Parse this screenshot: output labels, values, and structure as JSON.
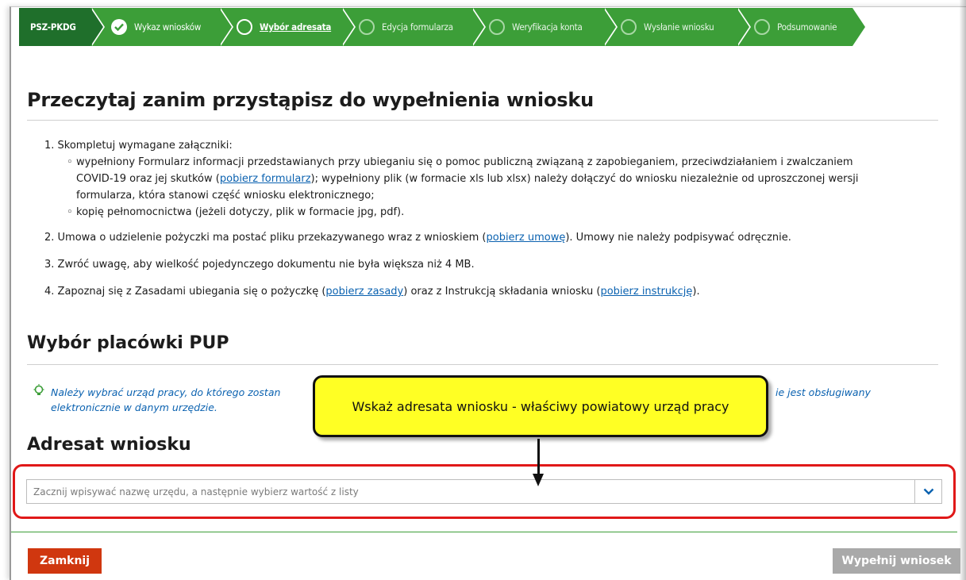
{
  "stepper": {
    "brand": "PSZ-PKDG",
    "steps": [
      {
        "label": "Wykaz wniosków",
        "state": "done"
      },
      {
        "label": "Wybór adresata",
        "state": "current"
      },
      {
        "label": "Edycja formularza",
        "state": "todo"
      },
      {
        "label": "Weryfikacja konta",
        "state": "todo"
      },
      {
        "label": "Wysłanie wniosku",
        "state": "todo"
      },
      {
        "label": "Podsumowanie",
        "state": "todo"
      }
    ]
  },
  "main": {
    "title": "Przeczytaj zanim przystąpisz do wypełnienia wniosku",
    "items": {
      "i1": "1. Skompletuj wymagane załączniki:",
      "s1a": "wypełniony Formularz informacji przedstawianych przy ubieganiu się o pomoc publiczną związaną z zapobieganiem, przeciwdziałaniem i zwalczaniem",
      "s1b": "COVID-19 oraz jej skutków (",
      "s1b_link": "pobierz formularz",
      "s1b_rest": "); wypełniony plik (w formacie xls lub xlsx) należy dołączyć do wniosku niezależnie od uproszczonej wersji",
      "s1c": "formularza, która stanowi część wniosku elektronicznego;",
      "s2": "kopię pełnomocnictwa (jeżeli dotyczy, plik w formacie jpg, pdf).",
      "i2a": "2. Umowa o udzielenie pożyczki ma postać pliku przekazywanego wraz z wnioskiem (",
      "i2_link": "pobierz umowę",
      "i2b": "). Umowy nie należy podpisywać odręcznie.",
      "i3": "3. Zwróć uwagę, aby wielkość pojedynczego dokumentu nie była większa niż 4 MB.",
      "i4a": "4. Zapoznaj się z Zasadami ubiegania się o pożyczkę (",
      "i4_link1": "pobierz zasady",
      "i4b": ") oraz z Instrukcją składania wniosku (",
      "i4_link2": "pobierz instrukcję",
      "i4c": ")."
    },
    "section_pup": "Wybór placówki PUP",
    "hint_line1_start": "Należy wybrać urząd pracy, do którego zostan",
    "hint_line1_end": "ie jest obsługiwany",
    "hint_line2": "elektronicznie w danym urzędzie.",
    "section_adresat": "Adresat wniosku",
    "search_placeholder": "Zacznij wpisywać nazwę urzędu, a następnie wybierz wartość z listy"
  },
  "callout": {
    "text": "Wskaż adresata wniosku - właściwy powiatowy urząd pracy"
  },
  "footer": {
    "close_label": "Zamknij",
    "fill_label": "Wypełnij wniosek"
  },
  "colors": {
    "stepper_green": "#3c9e38",
    "stepper_dark": "#1f6f2b",
    "link_blue": "#0b62b0",
    "close_red": "#d0370f",
    "disabled_gray": "#a9a9a9",
    "highlight_red": "#e01818",
    "callout_yellow": "#ffff24"
  }
}
